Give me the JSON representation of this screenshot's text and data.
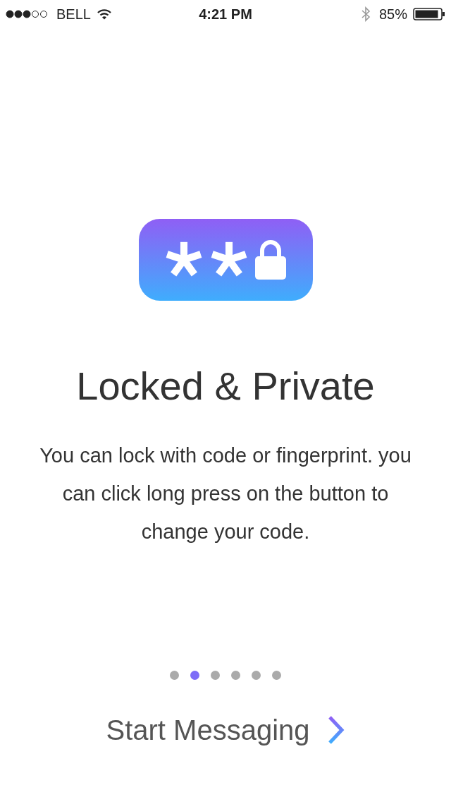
{
  "status_bar": {
    "carrier": "BELL",
    "time": "4:21 PM",
    "battery": "85%"
  },
  "title": "Locked & Private",
  "description": "You can lock with code or fingerprint. you can click long press on the button to change your code.",
  "pager": [
    {
      "selected": false
    },
    {
      "selected": true
    },
    {
      "selected": false
    },
    {
      "selected": false
    },
    {
      "selected": false
    },
    {
      "selected": false
    }
  ],
  "action": {
    "label": "Start Messaging"
  }
}
